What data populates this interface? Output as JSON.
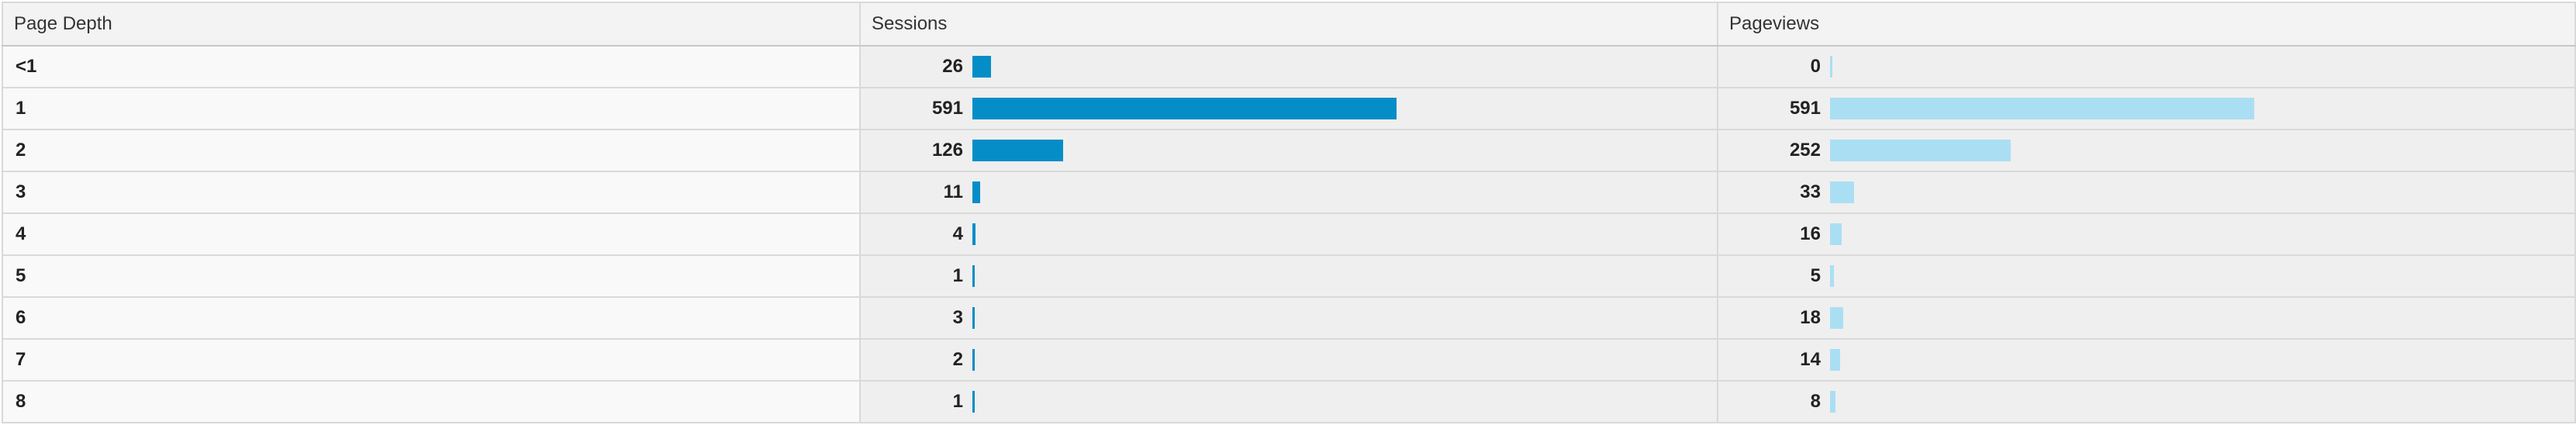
{
  "columns": {
    "dimension": "Page Depth",
    "sessions": "Sessions",
    "pageviews": "Pageviews"
  },
  "colors": {
    "sessions_bar": "#058dc7",
    "pageviews_bar": "#aadff3"
  },
  "rows": [
    {
      "depth": "<1",
      "sessions": "26",
      "pageviews": "0"
    },
    {
      "depth": "1",
      "sessions": "591",
      "pageviews": "591"
    },
    {
      "depth": "2",
      "sessions": "126",
      "pageviews": "252"
    },
    {
      "depth": "3",
      "sessions": "11",
      "pageviews": "33"
    },
    {
      "depth": "4",
      "sessions": "4",
      "pageviews": "16"
    },
    {
      "depth": "5",
      "sessions": "1",
      "pageviews": "5"
    },
    {
      "depth": "6",
      "sessions": "3",
      "pageviews": "18"
    },
    {
      "depth": "7",
      "sessions": "2",
      "pageviews": "14"
    },
    {
      "depth": "8",
      "sessions": "1",
      "pageviews": "8"
    }
  ]
}
